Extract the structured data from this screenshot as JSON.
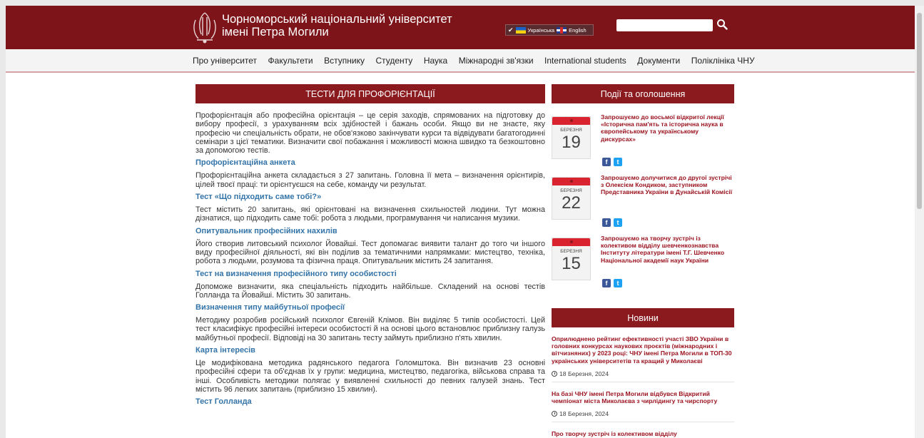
{
  "header": {
    "university_name_line1": "Чорноморський національний університет",
    "university_name_line2": "імені Петра Могили",
    "lang_ua": "Українська",
    "lang_en": "English"
  },
  "nav": {
    "items": [
      "Про університет",
      "Факультети",
      "Вступнику",
      "Студенту",
      "Наука",
      "Міжнародні зв'язки",
      "International students",
      "Документи",
      "Поліклініка ЧНУ"
    ]
  },
  "main": {
    "title": "Тести для профорієнтації",
    "intro": "Профорієнтація або професійна орієнтація – це серія заходів, спрямованих на підготовку до вибору професії, з урахуванням всіх здібностей і бажань особи. Якщо ви не знаєте, яку професію чи спеціальність обрати, не обов'язково закінчувати курси та відвідувати багатогодинні семінари з цієї тематики. Визначити свої побажання і можливості можна швидко та безкоштовно за допомогою тестів.",
    "sections": [
      {
        "heading": "Профорієнтаційна анкета",
        "text": "Профорієнтаційна анкета складається з 27 запитань. Головна її мета – визначення орієнтирів, цілей твоєї праці: ти орієнтуєшся на себе, команду чи результат."
      },
      {
        "heading": "Тест «Що підходить саме тобі?»",
        "text": "Тест містить 20 запитань, які орієнтовані на визначення схильностей людини. Тут можна дізнатися, що підходить саме тобі: робота з людьми, програмування чи написання музики."
      },
      {
        "heading": "Опитувальник професійних нахилів",
        "text": "Його створив литовський психолог Йовайші. Тест допомагає виявити талант до того чи іншого виду професійної діяльності, які він поділив за тематичними напрямками: мистецтво, техніка, робота з людьми, розумова та фізична праця. Опитувальник містить 24 запитання."
      },
      {
        "heading": "Тест на визначення професійного типу особистості",
        "text": "Допоможе визначити, яка спеціальність підходить найбільше. Складений на основі тестів Голланда та Йовайші. Містить 30 запитань."
      },
      {
        "heading": "Визначення типу майбутньої професії",
        "text": "Методику розробив російський психолог Євгеній Клімов. Він виділяє 5 типів особистості. Цей тест класифікує професійні інтереси особистості й на основі цього встановлює приблизну галузь майбутньої професії. Відповіді на 30 запитань тесту займуть приблизно п'ять хвилин."
      },
      {
        "heading": "Карта інтересів",
        "text": "Це модифікована методика радянського педагога Голомштока. Він визначив 23 основні професійні сфери та об'єднав їх у групи: медицина, мистецтво, педагогіка, військова справа та інші. Особливість методики полягає у виявленні схильності до певних галузей знань. Тест містить 96 легких запитань (приблизно 15 хвилин)."
      },
      {
        "heading": "Тест Голланда",
        "text": ""
      }
    ]
  },
  "sidebar": {
    "events_title": "Події та оголошення",
    "events": [
      {
        "month": "березня",
        "day": "19",
        "title": "Запрошуємо до восьмої відкритої лекції «Історична пам'ять та історична наука в європейському та українському дискурсах»"
      },
      {
        "month": "березня",
        "day": "22",
        "title": "Запрошуємо долучитися до другої зустрічі з Олексієм Кондиком, заступником Представника України в Дунайській Комісії"
      },
      {
        "month": "березня",
        "day": "15",
        "title": "Запрошуємо на творчу зустріч із колективом відділу шевченкознавства Інституту літератури імені Т.Г. Шевченко Національної академії наук України"
      }
    ],
    "fb_letter": "f",
    "tw_letter": "t",
    "news_title": "Новини",
    "news": [
      {
        "title": "Оприлюднено рейтинг ефективності участі ЗВО України в головних конкурсах наукових проєктів (міжнародних і вітчизняних) у 2023 році: ЧНУ імені Петра Могили в ТОП-30 українських університетів та кращий у Миколаєві",
        "date": "18 Березня, 2024"
      },
      {
        "title": "На базі ЧНУ імені Петра Могили відбувся Відкритий чемпіонат міста Миколаєва з чирлідингу та чирспорту",
        "date": "18 Березня, 2024"
      },
      {
        "title": "Про творчу зустріч із колективом відділу",
        "date": ""
      }
    ]
  }
}
